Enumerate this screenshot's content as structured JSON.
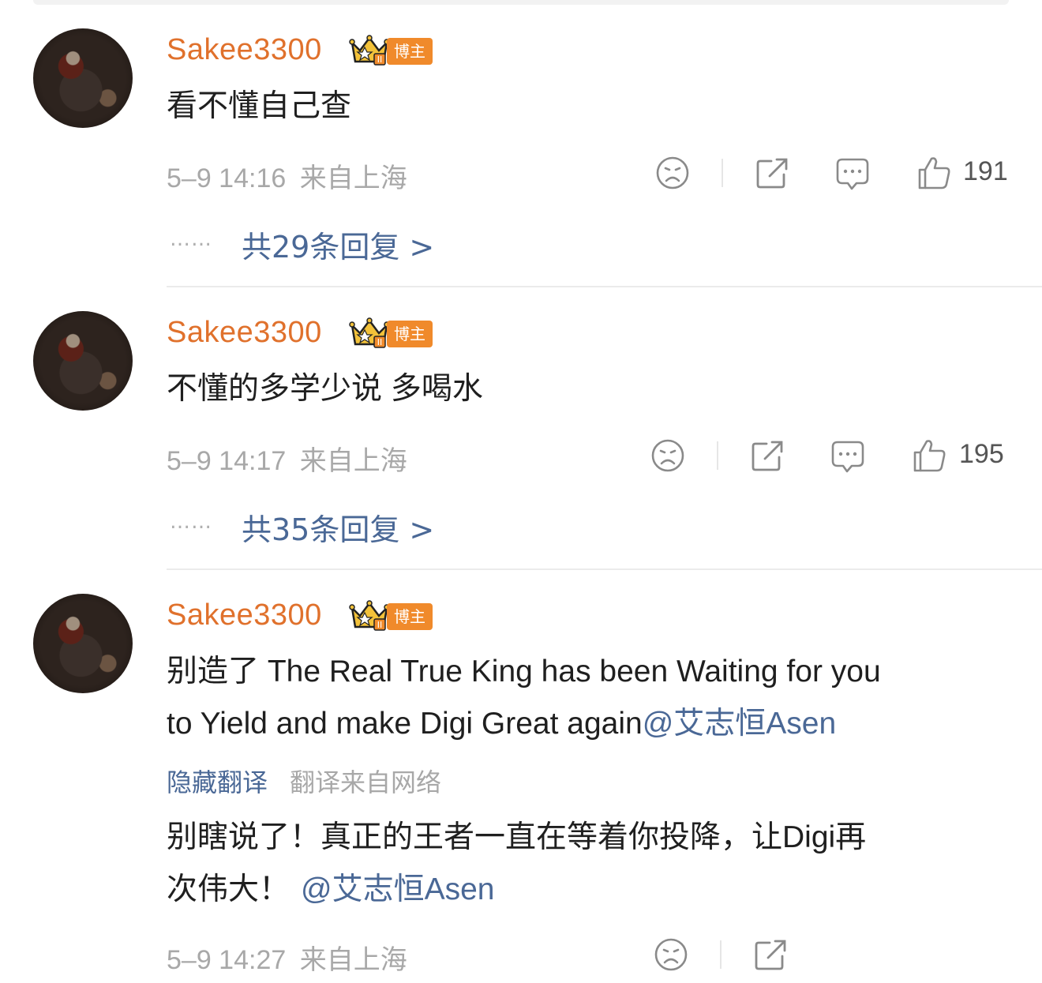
{
  "colors": {
    "username": "#e0712c",
    "badge": "#f08a2b",
    "link": "#4a6896",
    "meta": "#a8a8a8"
  },
  "comments": [
    {
      "username": "Sakee3300",
      "badge": "博主",
      "text": "看不懂自己查",
      "time": "5–9 14:16",
      "location": "来自上海",
      "likes": "191",
      "replies": "共29条回复 >"
    },
    {
      "username": "Sakee3300",
      "badge": "博主",
      "text": "不懂的多学少说 多喝水",
      "time": "5–9 14:17",
      "location": "来自上海",
      "likes": "195",
      "replies": "共35条回复 >"
    },
    {
      "username": "Sakee3300",
      "badge": "博主",
      "text_line1": "别造了 The Real True King has been Waiting for you",
      "text_line2": "to Yield and make Digi Great again",
      "mention": "@艾志恒Asen",
      "translate_toggle": "隐藏翻译",
      "translate_source": "翻译来自网络",
      "translation_line1": "别瞎说了！真正的王者一直在等着你投降，让Digi再",
      "translation_line2": "次伟大！",
      "translation_mention": "@艾志恒Asen",
      "time": "5–9 14:27",
      "location": "来自上海"
    }
  ],
  "dots": "……",
  "icons": [
    "sad-face-icon",
    "share-icon",
    "comment-icon",
    "thumbs-up-icon"
  ]
}
